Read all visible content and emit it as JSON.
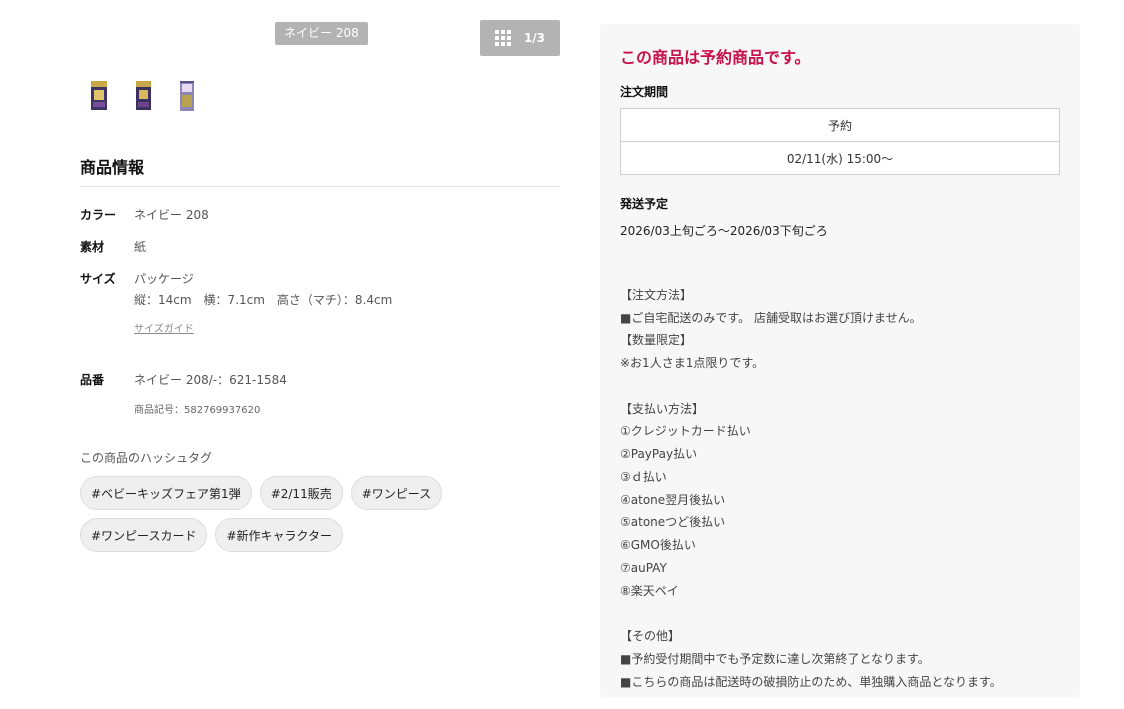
{
  "gallery": {
    "variant_badge": "ネイビー 208",
    "counter": "1/3",
    "grid_icon": "grid-icon",
    "thumbnails": [
      "product-box-front",
      "product-box-side",
      "product-booster-pack"
    ]
  },
  "product_info": {
    "title": "商品情報",
    "color": {
      "label": "カラー",
      "value": "ネイビー 208"
    },
    "material": {
      "label": "素材",
      "value": "紙"
    },
    "size": {
      "label": "サイズ",
      "line1": "パッケージ",
      "line2": "縦：14cm　横：7.1cm　高さ（マチ）：8.4cm",
      "guide_link": "サイズガイド"
    },
    "item_no": {
      "label": "品番",
      "value": "ネイビー 208/-：621-1584",
      "code": "商品記号：582769937620"
    }
  },
  "hashtags": {
    "title": "この商品のハッシュタグ",
    "items": [
      "#ベビーキッズフェア第1弾",
      "#2/11販売",
      "#ワンピース",
      "#ワンピースカード",
      "#新作キャラクター"
    ]
  },
  "preorder": {
    "title": "この商品は予約商品です。",
    "period_label": "注文期間",
    "period_header": "予約",
    "period_value": "02/11(水) 15:00〜",
    "shipping_label": "発送予定",
    "shipping_value": "2026/03上旬ごろ〜2026/03下旬ごろ",
    "notes": [
      "",
      "【注文方法】",
      "■ご自宅配送のみです。 店舗受取はお選び頂けません。",
      "【数量限定】",
      "※お1人さま1点限りです。",
      "",
      "【支払い方法】",
      "①クレジットカード払い",
      "②PayPay払い",
      "③ｄ払い",
      "④atone翌月後払い",
      "⑤atoneつど後払い",
      "⑥GMO後払い",
      "⑦auPAY",
      "⑧楽天ペイ",
      "",
      "【その他】",
      "■予約受付期間中でも予定数に達し次第終了となります。",
      "■こちらの商品は配送時の破損防止のため、単独購入商品となります。"
    ]
  },
  "colors": {
    "accent": "#c8104a",
    "badge_bg": "#b3b3b3",
    "panel_bg": "#f7f7f7",
    "tag_bg": "#efefef"
  }
}
